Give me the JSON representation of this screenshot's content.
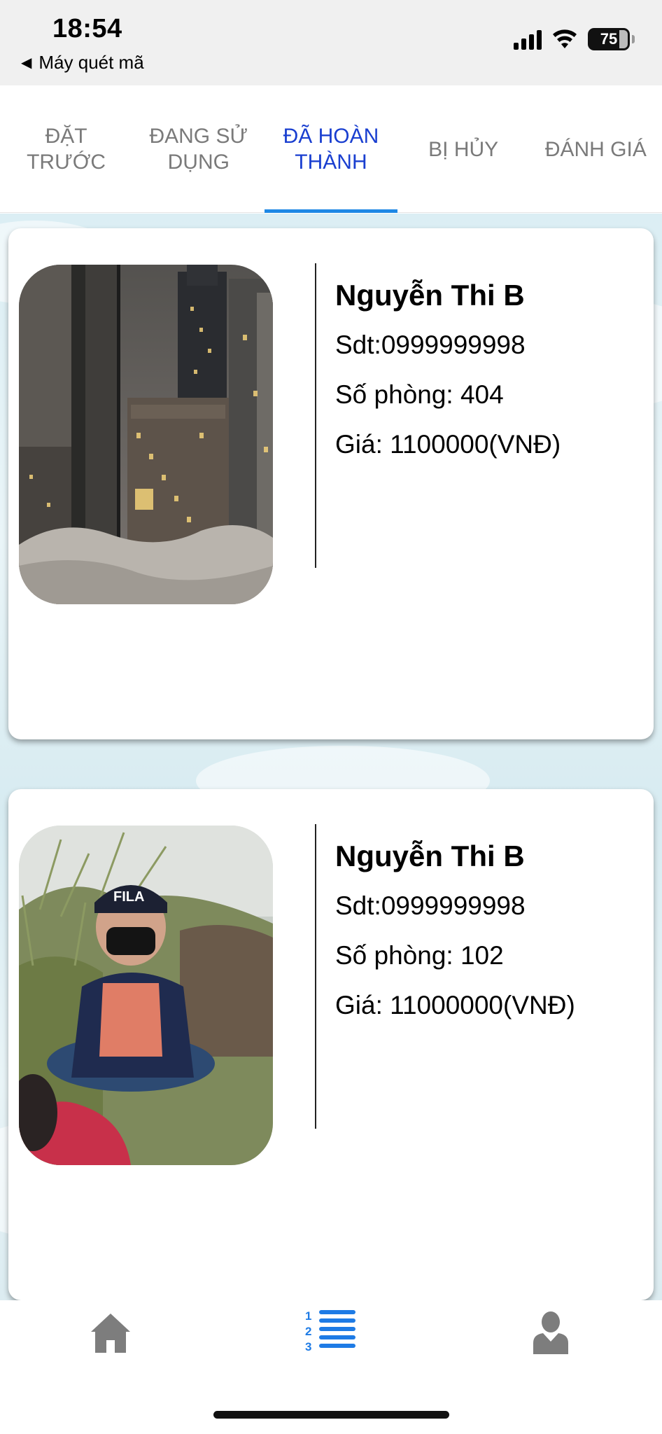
{
  "status_bar": {
    "time": "18:54",
    "back_app": "Máy quét mã",
    "battery": "75"
  },
  "tabs": [
    {
      "label": "ĐẶT TRƯỚC",
      "active": false
    },
    {
      "label": "ĐANG SỬ DỤNG",
      "active": false
    },
    {
      "label": "ĐÃ HOÀN THÀNH",
      "active": true
    },
    {
      "label": "BỊ HỦY",
      "active": false
    },
    {
      "label": "ĐÁNH GIÁ",
      "active": false
    }
  ],
  "bookings": [
    {
      "name": "Nguyễn Thi B",
      "phone": "Sdt:0999999998",
      "room": "Số phòng: 404",
      "price": "Giá: 1100000(VNĐ)",
      "photo": "city-night-window"
    },
    {
      "name": "Nguyễn Thi B",
      "phone": "Sdt:0999999998",
      "room": "Số phòng: 102",
      "price": "Giá: 11000000(VNĐ)",
      "photo": "person-outdoors"
    }
  ],
  "bottom_nav": [
    {
      "icon": "home-icon",
      "active": false
    },
    {
      "icon": "numbered-list-icon",
      "active": true
    },
    {
      "icon": "user-icon",
      "active": false
    }
  ],
  "colors": {
    "active_tab_text": "#1a3fd0",
    "active_tab_underline": "#1e88e5",
    "inactive_tab_text": "#7a7a7a",
    "active_nav_icon": "#1e7be5",
    "inactive_nav_icon": "#7d7d7d"
  }
}
